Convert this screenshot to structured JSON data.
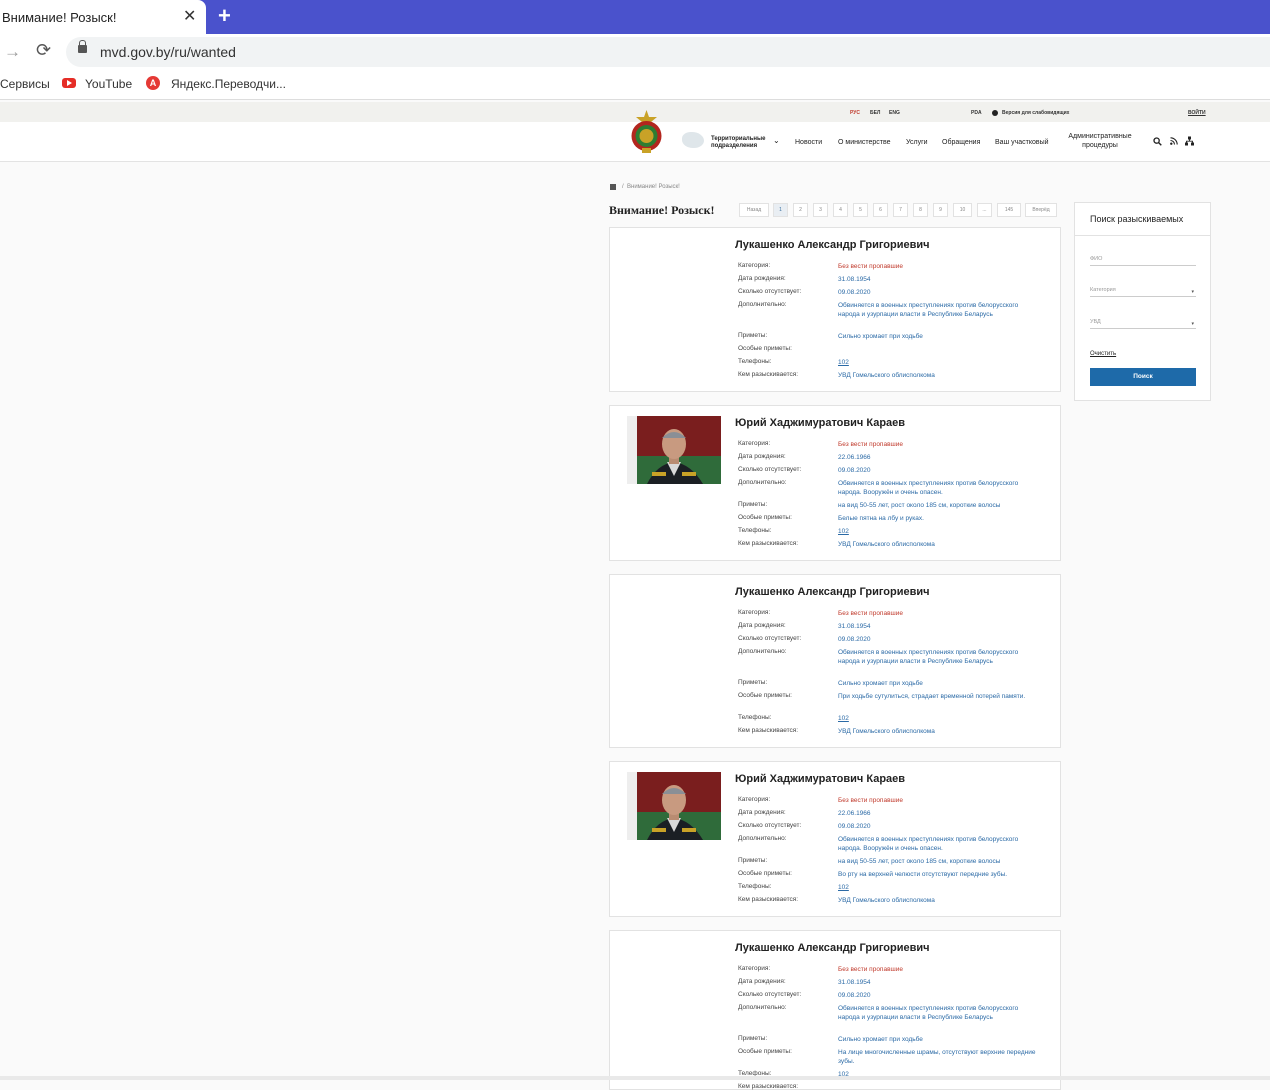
{
  "browser": {
    "tab_title": "Внимание! Розыск!",
    "tab_close": "✕",
    "new_tab": "+",
    "back_symbol": "→",
    "reload_symbol": "⟳",
    "url": "mvd.gov.by/ru/wanted",
    "bookmarks": [
      "Сервисы",
      "YouTube",
      "Яндекс.Переводчи..."
    ]
  },
  "site": {
    "langs": [
      "РУС",
      "БЕЛ",
      "ENG"
    ],
    "pda": "PDA",
    "low_vision": "Версия для слабовидящих",
    "login": "ВОЙТИ",
    "territorial": "Территориальные подразделения",
    "nav": [
      "Новости",
      "О министерстве",
      "Услуги",
      "Обращения",
      "Ваш участковый",
      "Административные процедуры"
    ],
    "icons": [
      "search-icon",
      "rss-icon",
      "sitemap-icon"
    ]
  },
  "main": {
    "breadcrumb": "Внимание! Розыск!",
    "title": "Внимание! Розыск!",
    "pagination": [
      "Назад",
      "1",
      "2",
      "3",
      "4",
      "5",
      "6",
      "7",
      "8",
      "9",
      "10",
      "...",
      "145",
      "Вперёд"
    ],
    "active_page": "1"
  },
  "labels": {
    "category": "Категория:",
    "birth": "Дата рождения:",
    "absent": "Сколько отсутствует:",
    "extra": "Дополнительно:",
    "signs": "Приметы:",
    "special": "Особые приметы:",
    "phones": "Телефоны:",
    "by": "Кем разыскивается:"
  },
  "cards": [
    {
      "name": "Лукашенко Александр Григориевич",
      "category": "Без вести пропавшие",
      "birth": "31.08.1954",
      "absent": "09.08.2020",
      "extra": "Обвиняется в военных преступлениях против белорусского народа и узурпации власти в Республике Беларусь",
      "signs": "Сильно хромает при ходьбе",
      "special": "",
      "phone": "102",
      "by": "УВД Гомельского облисполкома"
    },
    {
      "name": "Юрий Хаджимуратович Караев",
      "category": "Без вести пропавшие",
      "birth": "22.06.1966",
      "absent": "09.08.2020",
      "extra": "Обвиняется в военных преступлениях против белорусского народа. Вооружён и очень опасен.",
      "signs": "на вид 50-55 лет, рост около 185 см, короткие волосы",
      "special": "Белые пятна на лбу и руках.",
      "phone": "102",
      "by": "УВД Гомельского облисполкома"
    },
    {
      "name": "Лукашенко Александр Григориевич",
      "category": "Без вести пропавшие",
      "birth": "31.08.1954",
      "absent": "09.08.2020",
      "extra": "Обвиняется в военных преступлениях против белорусского народа и узурпации власти в Республике Беларусь",
      "signs": "Сильно хромает при ходьбе",
      "special": "При ходьбе сутулиться, страдает временной потерей памяти.",
      "phone": "102",
      "by": "УВД Гомельского облисполкома"
    },
    {
      "name": "Юрий Хаджимуратович Караев",
      "category": "Без вести пропавшие",
      "birth": "22.06.1966",
      "absent": "09.08.2020",
      "extra": "Обвиняется в военных преступлениях против белорусского народа. Вооружён и очень опасен.",
      "signs": "на вид 50-55 лет, рост около 185 см, короткие волосы",
      "special": "Во рту на верхней челюсти отсутствуют передние зубы.",
      "phone": "102",
      "by": "УВД Гомельского облисполкома"
    },
    {
      "name": "Лукашенко Александр Григориевич",
      "category": "Без вести пропавшие",
      "birth": "31.08.1954",
      "absent": "09.08.2020",
      "extra": "Обвиняется в военных преступлениях против белорусского народа и узурпации власти в Республике Беларусь",
      "signs": "Сильно хромает при ходьбе",
      "special": "На лице многочисленные шрамы, отсутствуют верхние передние зубы.",
      "phone": "102",
      "by": ""
    }
  ],
  "search": {
    "title": "Поиск разыскиваемых",
    "fio_placeholder": "ФИО",
    "category_placeholder": "Категория",
    "uvd_placeholder": "УВД",
    "clear": "Очистить",
    "button": "Поиск"
  },
  "colors": {
    "tab_bar": "#4a52cc",
    "accent_blue": "#1e6aa9",
    "category_red": "#c0392b"
  }
}
